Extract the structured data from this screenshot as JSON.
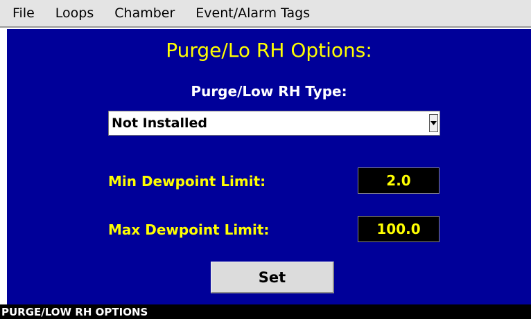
{
  "menu": {
    "items": [
      "File",
      "Loops",
      "Chamber",
      "Event/Alarm Tags"
    ]
  },
  "panel": {
    "title": "Purge/Lo RH Options:",
    "type_label": "Purge/Low RH Type:",
    "type_select": {
      "value": "Not Installed"
    },
    "min_dewpoint": {
      "label": "Min Dewpoint Limit:",
      "value": "2.0"
    },
    "max_dewpoint": {
      "label": "Max Dewpoint Limit:",
      "value": "100.0"
    },
    "set_label": "Set"
  },
  "status_bar": {
    "text": "PURGE/LOW RH OPTIONS"
  },
  "colors": {
    "panel_background": "#000099",
    "title": "#ffff00",
    "field_label": "#ffff00",
    "field_value_text": "#ffff00",
    "field_value_background": "#000000",
    "status_bar": "#000000"
  }
}
